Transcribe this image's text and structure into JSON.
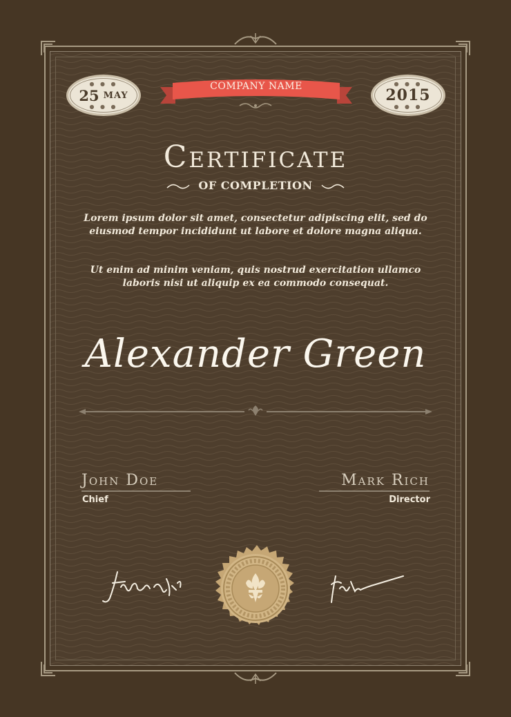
{
  "header": {
    "date_day": "25",
    "date_month": "MAY",
    "year": "2015",
    "company": "COMPANY NAME"
  },
  "title": "Certificate",
  "subtitle": "OF COMPLETION",
  "body": {
    "para1": "Lorem ipsum dolor sit amet, consectetur adipiscing elit, sed do eiusmod tempor incididunt ut labore et dolore magna aliqua.",
    "para2": "Ut enim ad minim veniam, quis nostrud exercitation ullamco laboris nisi ut aliquip ex ea commodo consequat."
  },
  "recipient": "Alexander Green",
  "signers": [
    {
      "name": "John Doe",
      "role": "Chief"
    },
    {
      "name": "Mark Rich",
      "role": "Director"
    }
  ],
  "colors": {
    "background": "#463624",
    "panel": "#4e3e2d",
    "ribbon": "#e8564a",
    "badge": "#ece5d6",
    "seal": "#c6a775",
    "text": "#f2eadb"
  },
  "icons": {
    "seal": "fleur-de-lis-seal-icon",
    "divider": "fleur-de-lis-divider-icon"
  }
}
